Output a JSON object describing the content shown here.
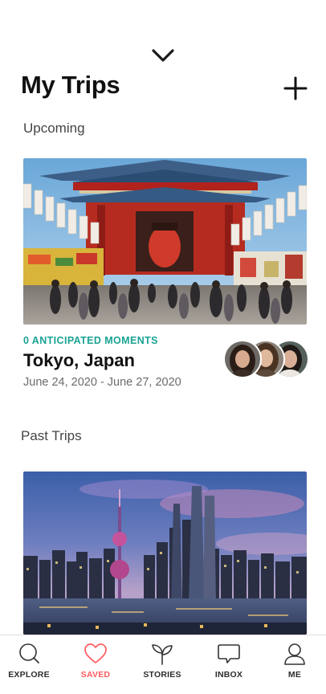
{
  "header": {
    "title": "My Trips",
    "collapse_icon": "chevron-down-icon",
    "add_icon": "plus-icon"
  },
  "upcoming": {
    "heading": "Upcoming",
    "trip": {
      "moments_label": "0 ANTICIPATED MOMENTS",
      "destination": "Tokyo, Japan",
      "dates": "June 24, 2020 - June 27, 2020",
      "traveler_count": 3
    }
  },
  "past": {
    "heading": "Past Trips"
  },
  "nav": {
    "items": [
      {
        "label": "EXPLORE",
        "icon": "search-icon"
      },
      {
        "label": "SAVED",
        "icon": "heart-icon",
        "active": true
      },
      {
        "label": "STORIES",
        "icon": "sprout-icon"
      },
      {
        "label": "INBOX",
        "icon": "chat-icon"
      },
      {
        "label": "ME",
        "icon": "user-icon"
      }
    ]
  },
  "colors": {
    "accent": "#ff5a5f",
    "moments_teal": "#1aa394",
    "text_primary": "#111111",
    "text_secondary": "#6b6b6b"
  }
}
